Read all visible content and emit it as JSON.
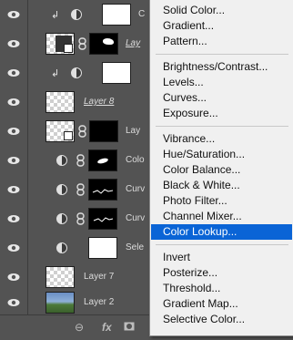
{
  "layers": [
    {
      "id": "r1",
      "name": "C",
      "type": "adjustment-white"
    },
    {
      "id": "r2",
      "name": "Lay",
      "type": "smart-masked"
    },
    {
      "id": "r3",
      "name": "",
      "type": "adjustment-white-clip"
    },
    {
      "id": "r4",
      "name": "Layer 8",
      "type": "empty-struck"
    },
    {
      "id": "r5",
      "name": "Lay",
      "type": "smart-black-mask"
    },
    {
      "id": "r6",
      "name": "Colo",
      "type": "adjust-mask"
    },
    {
      "id": "r7",
      "name": "Curv",
      "type": "adjust-mask"
    },
    {
      "id": "r8",
      "name": "Curv",
      "type": "adjust-mask"
    },
    {
      "id": "r9",
      "name": "Sele",
      "type": "adjust-white"
    },
    {
      "id": "r10",
      "name": "Layer 7",
      "type": "empty"
    },
    {
      "id": "r11",
      "name": "Layer 2",
      "type": "photo"
    }
  ],
  "footer": {
    "link_glyph": "⊖",
    "fx_label": "fx"
  },
  "menu": {
    "items": [
      "Solid Color...",
      "Gradient...",
      "Pattern...",
      "Brightness/Contrast...",
      "Levels...",
      "Curves...",
      "Exposure...",
      "Vibrance...",
      "Hue/Saturation...",
      "Color Balance...",
      "Black & White...",
      "Photo Filter...",
      "Channel Mixer...",
      "Color Lookup...",
      "Invert",
      "Posterize...",
      "Threshold...",
      "Gradient Map...",
      "Selective Color..."
    ],
    "selected": "Color Lookup..."
  }
}
